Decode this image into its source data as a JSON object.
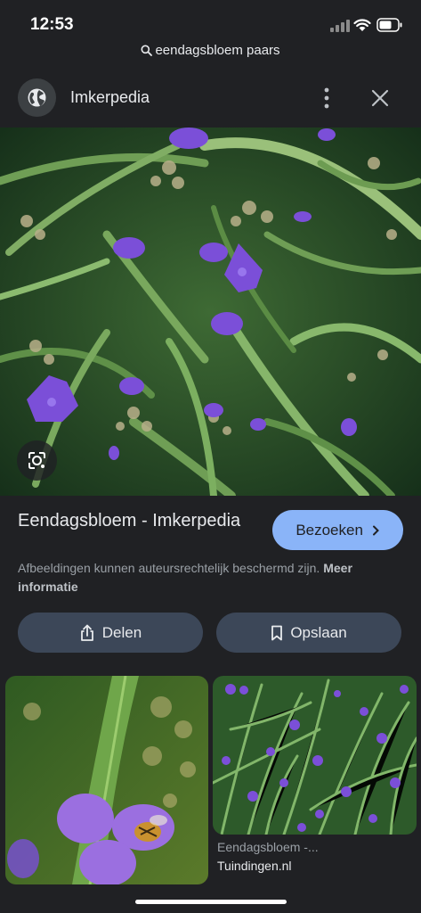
{
  "status_bar": {
    "time": "12:53"
  },
  "search": {
    "query": "eendagsbloem paars"
  },
  "source_header": {
    "site_name": "Imkerpedia"
  },
  "result": {
    "title": "Eendagsbloem - Imkerpedia",
    "visit_label": "Bezoeken",
    "copyright_text": "Afbeeldingen kunnen auteursrechtelijk beschermd zijn.",
    "more_info_label": "Meer informatie",
    "share_label": "Delen",
    "save_label": "Opslaan"
  },
  "related": [
    {
      "title": "",
      "source": ""
    },
    {
      "title": "Eendagsbloem -...",
      "source": "Tuindingen.nl"
    }
  ],
  "colors": {
    "background": "#202124",
    "visit_button": "#8ab4f8",
    "pill_button": "#3c4758",
    "flower_purple": "#7b4fd8"
  },
  "icons": [
    "search-icon",
    "globe-icon",
    "more-vert-icon",
    "close-icon",
    "lens-icon",
    "chevron-right-icon",
    "share-icon",
    "bookmark-icon"
  ]
}
